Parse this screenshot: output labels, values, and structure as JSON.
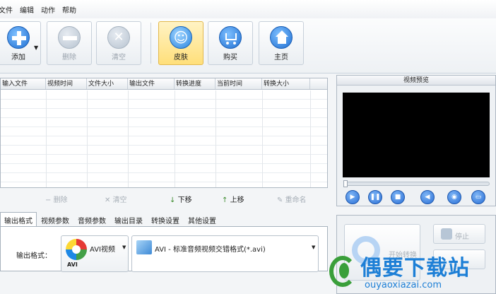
{
  "menu": [
    "文件",
    "编辑",
    "动作",
    "帮助"
  ],
  "toolbar": {
    "buttons": [
      {
        "label": "添加",
        "icon": "plus-icon"
      },
      {
        "label": "删除",
        "icon": "minus-icon"
      },
      {
        "label": "清空",
        "icon": "x-icon"
      },
      {
        "label": "皮肤",
        "icon": "smiley-icon"
      },
      {
        "label": "购买",
        "icon": "cart-icon"
      },
      {
        "label": "主页",
        "icon": "home-icon"
      }
    ]
  },
  "filelist": {
    "columns": [
      "输入文件",
      "视频时间",
      "文件大小",
      "输出文件",
      "转换进度",
      "当前时间",
      "转换大小"
    ]
  },
  "actions": {
    "delete": "删除",
    "clear": "清空",
    "down": "下移",
    "up": "上移",
    "rename": "重命名"
  },
  "tabs": [
    "输出格式",
    "视频参数",
    "音频参数",
    "输出目录",
    "转换设置",
    "其他设置"
  ],
  "format": {
    "label": "输出格式：",
    "category": "AVI视频",
    "category_badge": "AVI",
    "detail": "AVI - 标准音频视频交错格式(*.avi)"
  },
  "preview": {
    "title": "视频预览"
  },
  "convert": {
    "start": "开始转换",
    "stop": "停止"
  },
  "watermark": {
    "title": "偶要下载站",
    "url": "ouyaoxiazai.com"
  },
  "colors": {
    "accent": "#2a6fd6",
    "skin_highlight": "#ffdf7a",
    "watermark": "#1d7fd6"
  }
}
